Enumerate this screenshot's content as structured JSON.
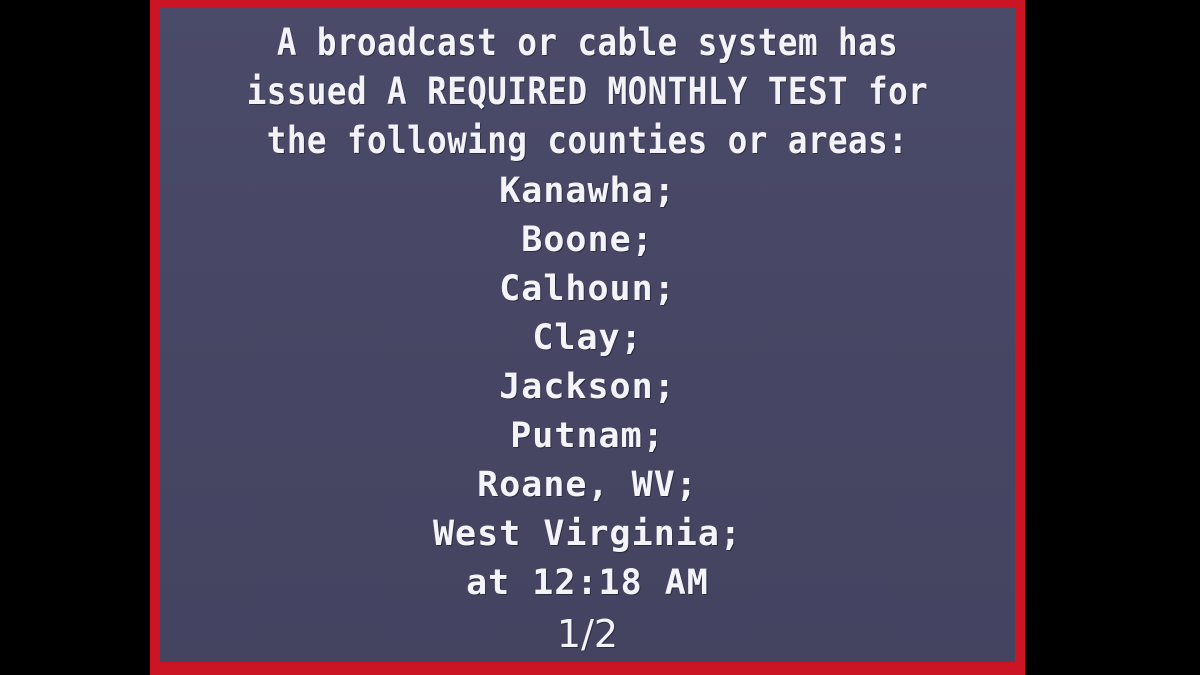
{
  "screen": {
    "background_color": "#000000",
    "card_border_color": "#cc1524",
    "card_background_color": "#474765",
    "text_color": "#f2f2f7"
  },
  "alert": {
    "header_lines": [
      "A broadcast or cable system has",
      "issued A REQUIRED MONTHLY TEST for",
      "the following counties or areas:"
    ],
    "areas": [
      "Kanawha;",
      "Boone;",
      "Calhoun;",
      "Clay;",
      "Jackson;",
      "Putnam;",
      "Roane, WV;",
      "West Virginia;"
    ],
    "time_line": "at 12:18 AM",
    "page_indicator": "1/2"
  }
}
